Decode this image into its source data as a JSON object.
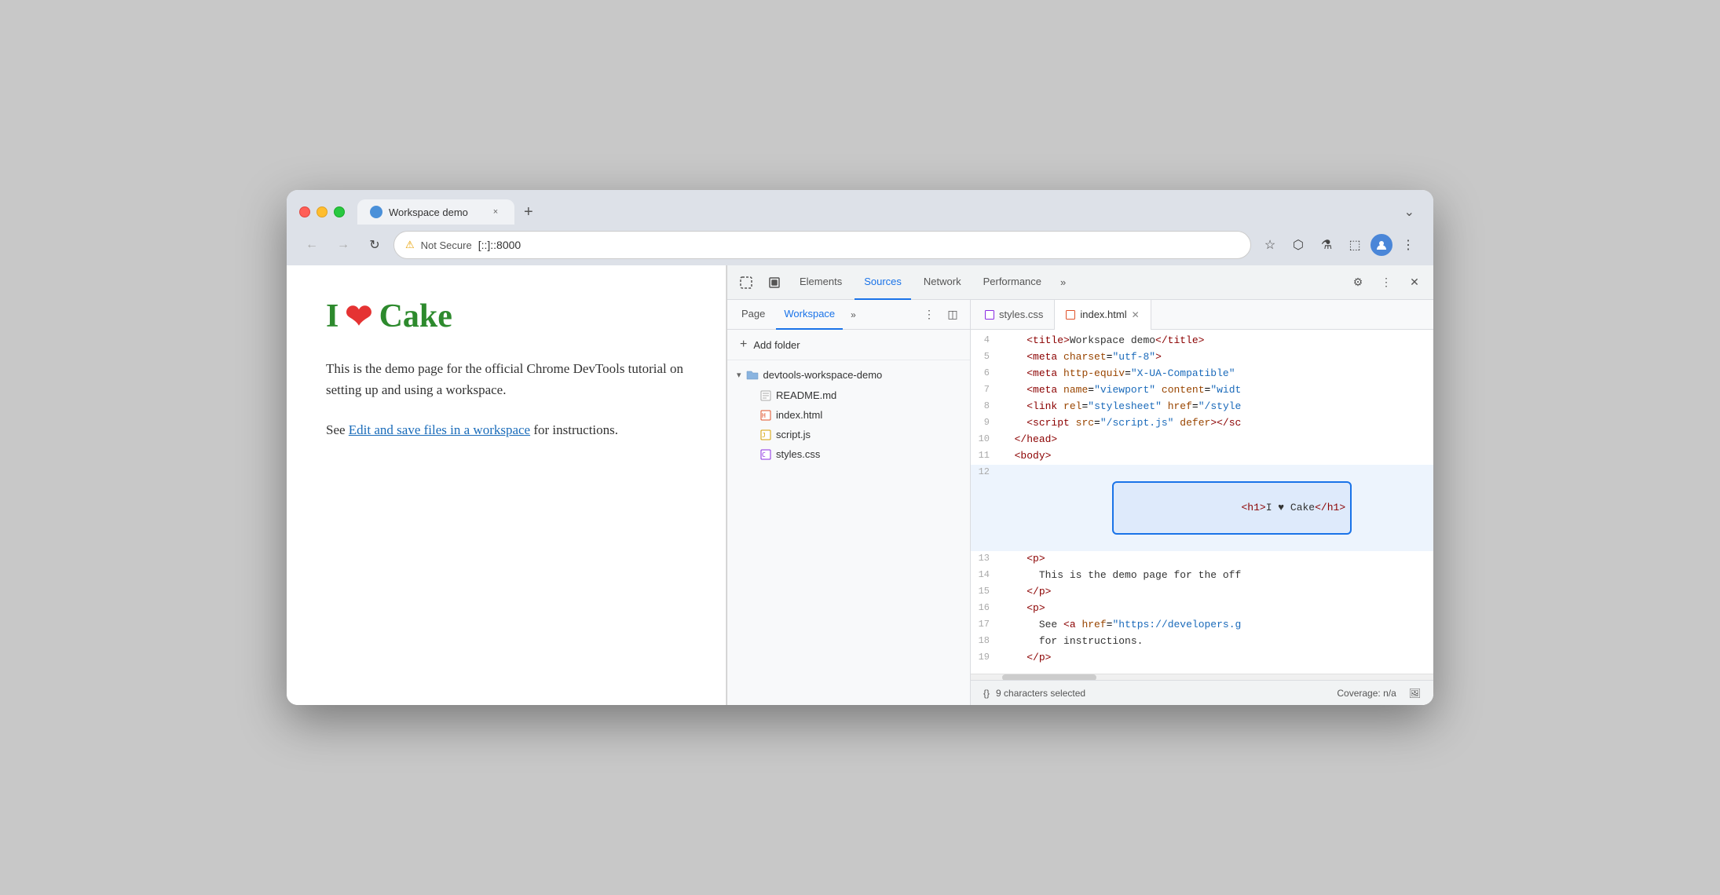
{
  "browser": {
    "tab_title": "Workspace demo",
    "tab_favicon": "🌐",
    "tab_close": "×",
    "new_tab": "+",
    "dropdown": "⌄",
    "back_btn": "←",
    "forward_btn": "→",
    "refresh_btn": "↻",
    "not_secure_icon": "⚠",
    "not_secure_label": "Not Secure",
    "url": "[::]::8000",
    "bookmark_icon": "☆",
    "extension_icon": "⬡",
    "labs_icon": "⚗",
    "sidebar_icon": "⬚",
    "profile_icon": "👤",
    "menu_icon": "⋮"
  },
  "page": {
    "heading_green": "I",
    "heading_heart": "❤",
    "heading_cake": "Cake",
    "para1": "This is the demo page for the official Chrome\nDevTools tutorial on setting up and using a\nworkspace.",
    "para2_prefix": "See ",
    "para2_link": "Edit and save files in a workspace",
    "para2_suffix": " for\ninstructions."
  },
  "devtools": {
    "toolbar": {
      "cursor_icon": "⬚",
      "inspect_icon": "⬜",
      "tabs": [
        "Elements",
        "Sources",
        "Network",
        "Performance"
      ],
      "active_tab": "Sources",
      "more_icon": "»",
      "settings_icon": "⚙",
      "menu_icon": "⋮",
      "close_icon": "×"
    },
    "sources": {
      "tabs": [
        "Page",
        "Workspace"
      ],
      "active_tab": "Workspace",
      "more_icon": "»",
      "menu_icon": "⋮",
      "sidebar_icon": "⬚",
      "add_folder_label": "Add folder",
      "folder_name": "devtools-workspace-demo",
      "files": [
        {
          "name": "README.md",
          "icon_color": "#555"
        },
        {
          "name": "index.html",
          "icon_color": "#e0522a"
        },
        {
          "name": "script.js",
          "icon_color": "#d4a000"
        },
        {
          "name": "styles.css",
          "icon_color": "#8a2be2"
        }
      ]
    },
    "editor": {
      "tabs": [
        {
          "name": "styles.css",
          "icon": "📄",
          "active": false
        },
        {
          "name": "index.html",
          "icon": "📄",
          "active": true,
          "closeable": true
        }
      ],
      "lines": [
        {
          "num": 4,
          "content": "    <title>Workspace demo</title>"
        },
        {
          "num": 5,
          "content": "    <meta charset=\"utf-8\">"
        },
        {
          "num": 6,
          "content": "    <meta http-equiv=\"X-UA-Compatible\""
        },
        {
          "num": 7,
          "content": "    <meta name=\"viewport\" content=\"widt"
        },
        {
          "num": 8,
          "content": "    <link rel=\"stylesheet\" href=\"/style"
        },
        {
          "num": 9,
          "content": "    <script src=\"/script.js\" defer></sc"
        },
        {
          "num": 10,
          "content": "  </head>"
        },
        {
          "num": 11,
          "content": "  <body>"
        },
        {
          "num": 12,
          "content": "    <h1>I ♥ Cake</h1>",
          "highlight": true
        },
        {
          "num": 13,
          "content": "    <p>"
        },
        {
          "num": 14,
          "content": "      This is the demo page for the off"
        },
        {
          "num": 15,
          "content": "    </p>"
        },
        {
          "num": 16,
          "content": "    <p>"
        },
        {
          "num": 17,
          "content": "      See <a href=\"https://developers.g"
        },
        {
          "num": 18,
          "content": "      for instructions."
        },
        {
          "num": 19,
          "content": "    </p>"
        }
      ]
    },
    "statusbar": {
      "format_icon": "{}",
      "selection_text": "9 characters selected",
      "coverage_label": "Coverage: n/a",
      "screenshot_icon": "🖼"
    }
  }
}
